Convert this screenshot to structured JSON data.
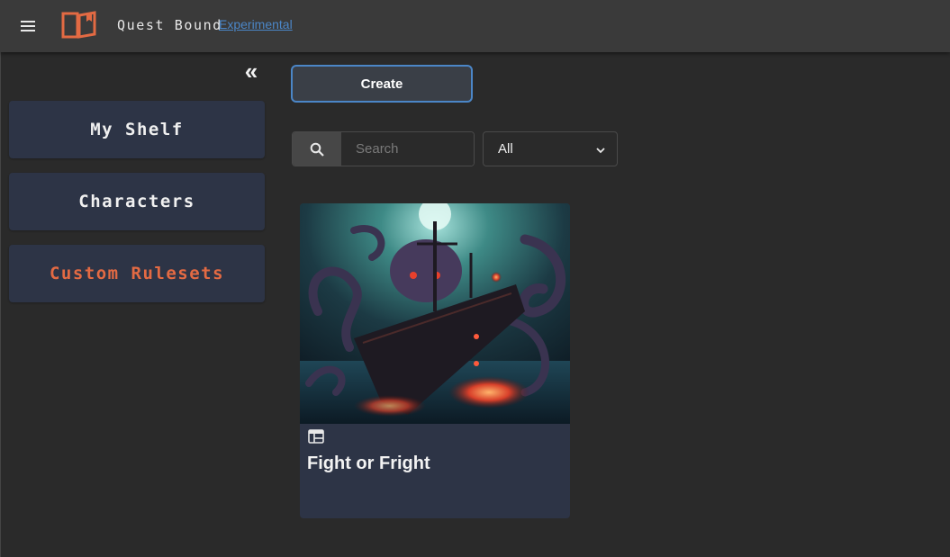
{
  "app": {
    "title": "Quest Bound",
    "badge_label": "Experimental",
    "accent_color": "#e36a43",
    "link_color": "#4b86c7"
  },
  "icons": {
    "menu": "hamburger-menu-icon",
    "logo": "open-book-logo",
    "collapse": "double-chevron-left-icon",
    "search": "search-icon",
    "dropdown": "chevron-down-icon",
    "card_type": "web-layout-icon"
  },
  "sidebar": {
    "collapse_label": "«",
    "items": [
      {
        "label": "My Shelf",
        "active": false
      },
      {
        "label": "Characters",
        "active": false
      },
      {
        "label": "Custom Rulesets",
        "active": true
      }
    ]
  },
  "main": {
    "create_label": "Create",
    "search": {
      "placeholder": "Search",
      "value": ""
    },
    "filter": {
      "selected": "All"
    },
    "cards": [
      {
        "title": "Fight or Fright",
        "image": "kraken-ship-illustration"
      }
    ]
  }
}
